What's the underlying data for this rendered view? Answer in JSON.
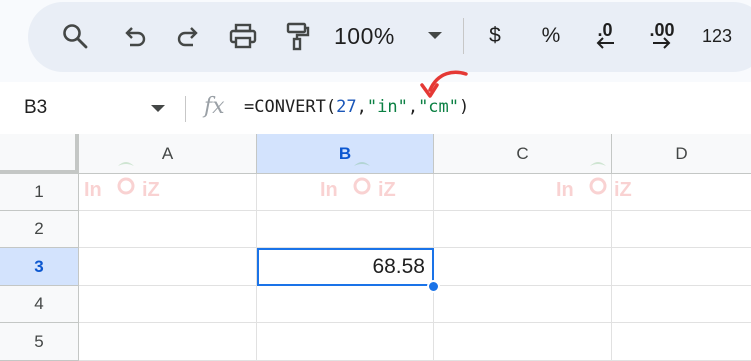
{
  "toolbar": {
    "zoom_value": "100%",
    "currency_label": "$",
    "percent_label": "%",
    "decrease_decimal_label": ".0",
    "increase_decimal_label": ".00",
    "more_formats_label": "123",
    "icons": [
      "search-icon",
      "undo-icon",
      "redo-icon",
      "print-icon",
      "paint-format-icon",
      "chevron-down-icon",
      "arrow-left-icon",
      "arrow-right-icon"
    ]
  },
  "formula_bar": {
    "cell_reference": "B3",
    "fx_label": "fx",
    "formula_prefix": "=CONVERT(",
    "formula_number": "27",
    "formula_comma_1": ",",
    "formula_arg_from": "\"in\"",
    "formula_comma_2": ",",
    "formula_arg_to": "\"cm\"",
    "formula_suffix": ")"
  },
  "sheet": {
    "columns": [
      "A",
      "B",
      "C",
      "D"
    ],
    "rows": [
      "1",
      "2",
      "3",
      "4",
      "5"
    ],
    "selected_cell": {
      "column": "B",
      "row": "3",
      "value": "68.58"
    }
  },
  "watermark": {
    "text_left": "In",
    "text_right": "iZ"
  },
  "colors": {
    "accent_blue": "#1a73e8",
    "header_selected": "#d3e3fd",
    "string_green": "#0b8043",
    "number_blue": "#1a56b8",
    "annotation_red": "#e53935"
  }
}
